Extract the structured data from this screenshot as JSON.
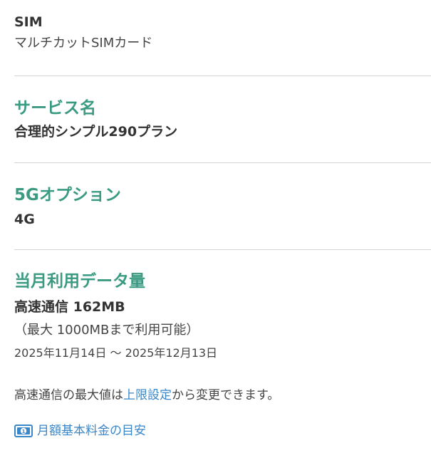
{
  "sim": {
    "title": "SIM",
    "value": "マルチカットSIMカード"
  },
  "service": {
    "heading": "サービス名",
    "value": "合理的シンプル290プラン"
  },
  "option5g": {
    "heading": "5Gオプション",
    "value": "4G"
  },
  "usage": {
    "heading": "当月利用データ量",
    "value": "高速通信 162MB",
    "limit_note": "（最大 1000MBまで利用可能）",
    "period": "2025年11月14日 ～ 2025年12月13日"
  },
  "footer": {
    "note_prefix": "高速通信の最大値は",
    "note_link": "上限設定",
    "note_suffix": "から変更できます。",
    "guide_link": "月額基本料金の目安",
    "guide_icon": "money-icon"
  },
  "colors": {
    "heading_accent": "#3a9a82",
    "link": "#3a86c8"
  }
}
